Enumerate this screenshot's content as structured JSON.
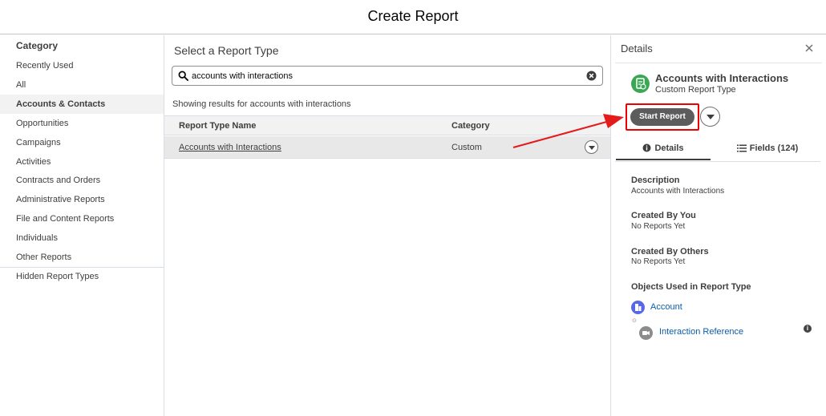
{
  "modal": {
    "title": "Create Report"
  },
  "categories": {
    "header": "Category",
    "items": [
      {
        "label": "Recently Used",
        "selected": false
      },
      {
        "label": "All",
        "selected": false
      },
      {
        "label": "Accounts & Contacts",
        "selected": true
      },
      {
        "label": "Opportunities",
        "selected": false
      },
      {
        "label": "Campaigns",
        "selected": false
      },
      {
        "label": "Activities",
        "selected": false
      },
      {
        "label": "Contracts and Orders",
        "selected": false
      },
      {
        "label": "Administrative Reports",
        "selected": false
      },
      {
        "label": "File and Content Reports",
        "selected": false
      },
      {
        "label": "Individuals",
        "selected": false
      },
      {
        "label": "Other Reports",
        "selected": false
      }
    ],
    "hidden": "Hidden Report Types"
  },
  "report_types": {
    "title": "Select a Report Type",
    "search": {
      "value": "accounts with interactions",
      "icon": "search-icon",
      "clear_icon": "clear-icon"
    },
    "results_note": "Showing results for accounts with interactions",
    "columns": [
      "Report Type Name",
      "Category"
    ],
    "rows": [
      {
        "name": "Accounts with Interactions",
        "category": "Custom"
      }
    ]
  },
  "details": {
    "title": "Details",
    "report_type_name": "Accounts with Interactions",
    "report_type_sub": "Custom Report Type",
    "start_button": "Start Report",
    "tabs": [
      {
        "label": "Details",
        "icon": "info-icon",
        "active": true
      },
      {
        "label": "Fields (124)",
        "icon": "list-icon",
        "active": false
      }
    ],
    "sections": [
      {
        "label": "Description",
        "value": "Accounts with Interactions"
      },
      {
        "label": "Created By You",
        "value": "No Reports Yet"
      },
      {
        "label": "Created By Others",
        "value": "No Reports Yet"
      }
    ],
    "objects_label": "Objects Used in Report Type",
    "objects": [
      {
        "name": "Account",
        "icon": "account-icon",
        "color": "#5867e8"
      },
      {
        "name": "Interaction Reference",
        "icon": "interaction-icon",
        "color": "#8c8c8c"
      }
    ],
    "glyph": "⊙"
  },
  "colors": {
    "accent_green": "#3ba755",
    "highlight_red": "#e00",
    "link_blue": "#0b5cab",
    "start_button_bg": "#5c5c5c"
  }
}
